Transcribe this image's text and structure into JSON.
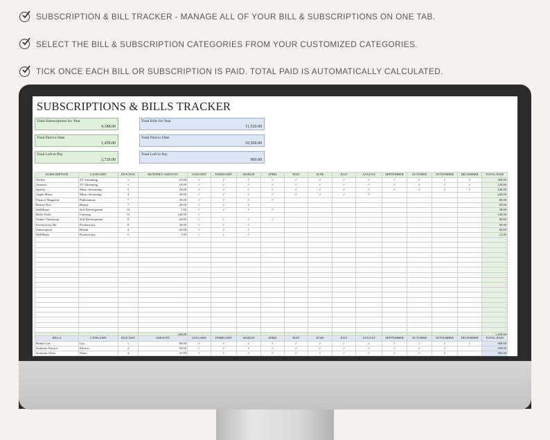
{
  "features": [
    "SUBSCRIPTION & BILL TRACKER - MANAGE ALL OF YOUR BILL & SUBSCRIPTIONS ON ONE TAB.",
    "SELECT THE BILL & SUBSCRIPTION CATEGORIES FROM YOUR CUSTOMIZED CATEGORIES.",
    "TICK ONCE EACH BILL OR SUBSCRIPTION IS PAID. TOTAL PAID IS AUTOMATICALLY CALCULATED."
  ],
  "sheet": {
    "title": "SUBSCRIPTIONS & BILLS TRACKER",
    "summary": {
      "subs_year": {
        "label": "Total Subscriptions for Year",
        "value": "4,188.00"
      },
      "subs_paid": {
        "label": "Total Paid to Date",
        "value": "1,459.00"
      },
      "subs_left": {
        "label": "Total Left to Pay",
        "value": "2,729.00"
      },
      "bills_year": {
        "label": "Total Bills for Year",
        "value": "11,520.00"
      },
      "bills_paid": {
        "label": "Total Paid to Date",
        "value": "10,560.00"
      },
      "bills_left": {
        "label": "Total Left to Pay",
        "value": "960.00"
      }
    },
    "months": [
      "JANUARY",
      "FEBRUARY",
      "MARCH",
      "APRIL",
      "MAY",
      "JUNE",
      "JULY",
      "AUGUST",
      "SEPTEMBER",
      "OCTOBER",
      "NOVEMBER",
      "DECEMBER"
    ],
    "tick": "✓",
    "subscriptions": {
      "headers": {
        "name": "SUBSCRIPTION",
        "category": "CATEGORY",
        "due": "DUE DAY",
        "amount": "MONTHLY AMOUNT",
        "total": "TOTAL PAID"
      },
      "rows": [
        {
          "name": "Netflix",
          "category": "TV Streaming",
          "due": "1",
          "amount": "25.00",
          "paid": 12,
          "total": "300.00"
        },
        {
          "name": "Amazon",
          "category": "TV Streaming",
          "due": "1",
          "amount": "10.00",
          "paid": 12,
          "total": "120.00"
        },
        {
          "name": "Spotify",
          "category": "Music Streaming",
          "due": "5",
          "amount": "20.00",
          "paid": 12,
          "total": "240.00"
        },
        {
          "name": "Apple Music",
          "category": "Music Streaming",
          "due": "3",
          "amount": "30.00",
          "paid": 8,
          "total": "240.00"
        },
        {
          "name": "Finance Magazine",
          "category": "Publications",
          "due": "7",
          "amount": "20.00",
          "paid": 4,
          "total": "80.00"
        },
        {
          "name": "Beauty Box",
          "category": "Beauty",
          "due": "7",
          "amount": "20.00",
          "paid": 3,
          "total": "60.00"
        },
        {
          "name": "SkillShare",
          "category": "Self Development",
          "due": "14",
          "amount": "7.00",
          "paid": 4,
          "total": "28.00"
        },
        {
          "name": "Hello Fresh",
          "category": "Catering",
          "due": "15",
          "amount": "140.00",
          "paid": 1,
          "total": "140.00"
        },
        {
          "name": "Online Classroom",
          "category": "Self Development",
          "due": "8",
          "amount": "20.00",
          "paid": 4,
          "total": "80.00"
        },
        {
          "name": "Productivity Hu",
          "category": "Productivity",
          "due": "8",
          "amount": "30.00",
          "paid": 3,
          "total": "90.00"
        },
        {
          "name": "Subscription",
          "category": "Health",
          "due": "3",
          "amount": "20.00",
          "paid": 3,
          "total": "60.00"
        },
        {
          "name": "SkillShare",
          "category": "Productivity",
          "due": "5",
          "amount": "7.00",
          "paid": 3,
          "total": "21.00"
        }
      ],
      "empty_rows": 19,
      "empty_total": "-",
      "amount_total": "349.00",
      "paid_total": "1,459.00"
    },
    "bills": {
      "headers": {
        "name": "BILLS",
        "category": "CATEGORY",
        "due": "DUE DAY",
        "amount": "AMOUNT",
        "total": "TOTAL PAID"
      },
      "rows": [
        {
          "name": "British Gas",
          "category": "Gas",
          "due": "1",
          "amount": "80.00",
          "paid": 12,
          "total": "960.00"
        },
        {
          "name": "Southern Electric",
          "category": "Electric",
          "due": "2",
          "amount": "50.00",
          "paid": 11,
          "total": "500.00"
        },
        {
          "name": "Southern Water",
          "category": "Water",
          "due": "3",
          "amount": "35.00",
          "paid": 11,
          "total": "385.00"
        }
      ]
    }
  }
}
